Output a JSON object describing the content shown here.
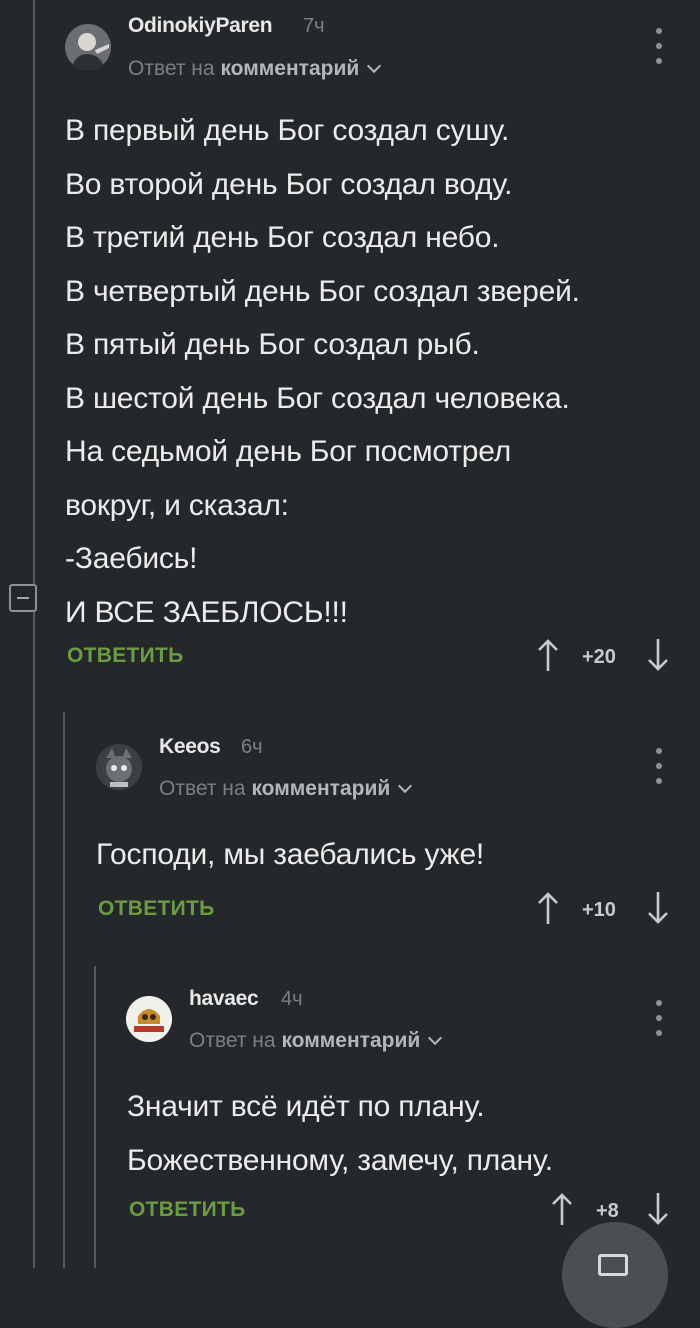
{
  "comments": [
    {
      "author": "OdinokiyParen",
      "time": "7ч",
      "reply_prefix": "Ответ на",
      "reply_target": "комментарий",
      "lines": [
        "В первый день Бог создал сушу.",
        "Во второй день Бог создал воду.",
        "В третий день Бог создал небо.",
        "В четвертый день Бог создал зверей.",
        "В пятый день Бог создал рыб.",
        "В шестой день Бог создал человека.",
        "На седьмой день Бог посмотрел",
        "вокруг, и сказал:",
        "-Заебись!",
        "И ВСЕ ЗАЕБЛОСЬ!!!"
      ],
      "reply_label": "ОТВЕТИТЬ",
      "score": "+20"
    },
    {
      "author": "Keeos",
      "time": "6ч",
      "reply_prefix": "Ответ на",
      "reply_target": "комментарий",
      "lines": [
        "Господи, мы заебались уже!"
      ],
      "reply_label": "ОТВЕТИТЬ",
      "score": "+10"
    },
    {
      "author": "havaec",
      "time": "4ч",
      "reply_prefix": "Ответ на",
      "reply_target": "комментарий",
      "lines": [
        "Значит всё идёт по плану.",
        "Божественному, замечу, плану."
      ],
      "reply_label": "ОТВЕТИТЬ",
      "score": "+8"
    }
  ],
  "colors": {
    "background": "#24282b",
    "accent_green": "#6b9b43",
    "muted_text": "#7c8084"
  },
  "icons": [
    "collapse-icon",
    "upvote-arrow-icon",
    "downvote-arrow-icon",
    "more-vertical-icon",
    "chevron-down-icon",
    "comment-fab-icon"
  ]
}
